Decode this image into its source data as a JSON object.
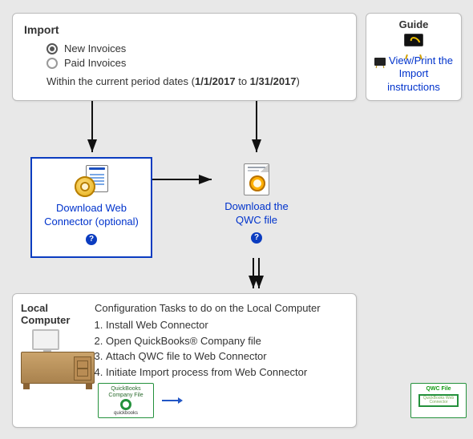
{
  "import": {
    "title": "Import",
    "options": {
      "new_invoices": "New Invoices",
      "paid_invoices": "Paid Invoices"
    },
    "period_prefix": "Within the current period dates (",
    "period_start": "1/1/2017",
    "period_to": " to ",
    "period_end": "1/31/2017",
    "period_suffix": ")"
  },
  "guide": {
    "title": "Guide",
    "link": "View/Print the Import instructions"
  },
  "flow": {
    "wc_label": "Download Web Connector (optional)",
    "qwc_label": "Download the QWC file",
    "help": "?"
  },
  "local": {
    "title": "Local Computer",
    "tasks_title": "Configuration Tasks to do on the Local Computer",
    "tasks": [
      "Install Web Connector",
      "Open QuickBooks® Company file",
      "Attach QWC file to Web Connector",
      "Initiate Import process from Web Connector"
    ],
    "mini_company_top": "QuickBooks",
    "mini_company_bottom": "Company File",
    "mini_company_foot": "quickbooks",
    "mini_qwc_top": "QWC File",
    "mini_qwc_inner": "QuickBooks Web Connector"
  }
}
